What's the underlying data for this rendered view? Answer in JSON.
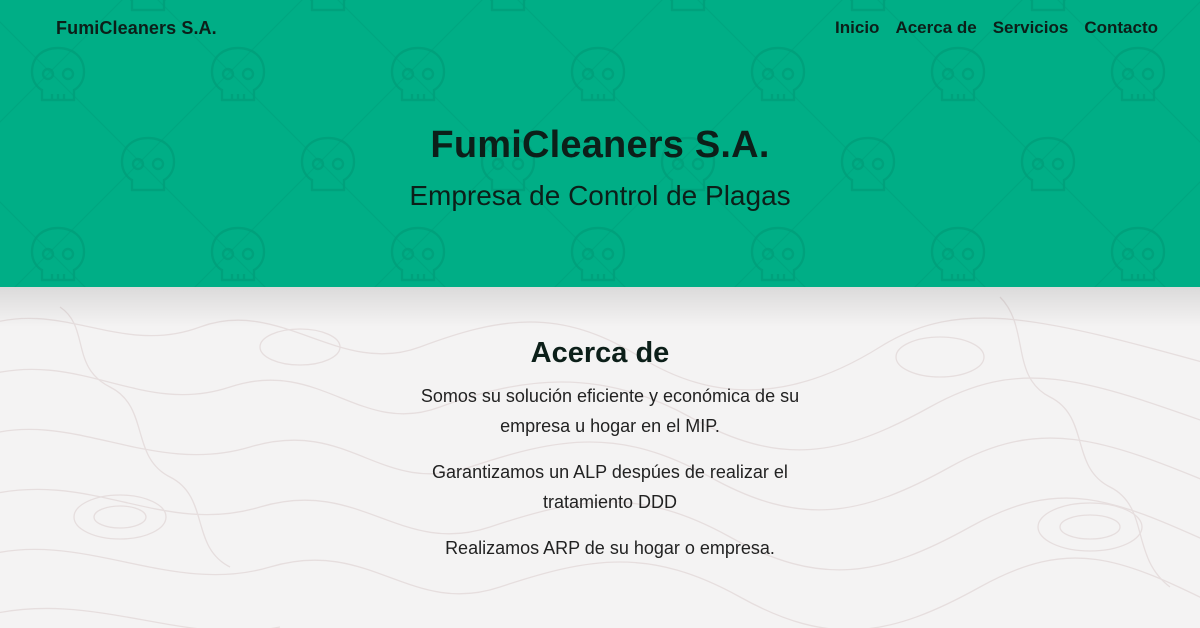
{
  "navbar": {
    "brand": "FumiCleaners S.A.",
    "links": [
      {
        "label": "Inicio"
      },
      {
        "label": "Acerca de"
      },
      {
        "label": "Servicios"
      },
      {
        "label": "Contacto"
      }
    ]
  },
  "hero": {
    "title": "FumiCleaners S.A.",
    "subtitle": "Empresa de Control de Plagas",
    "background_color": "#00ae86",
    "pattern_icon": "skull-icon"
  },
  "about": {
    "title": "Acerca de",
    "paragraphs": [
      "Somos su solución eficiente y económica de su empresa u hogar en el MIP.",
      "Garantizamos un ALP despúes de realizar el tratamiento DDD",
      "Realizamos ARP de su hogar o empresa."
    ],
    "background_color": "#f4f3f3",
    "pattern": "topographic-lines"
  },
  "colors": {
    "text_dark": "#0c1f19",
    "accent": "#00ae86"
  }
}
